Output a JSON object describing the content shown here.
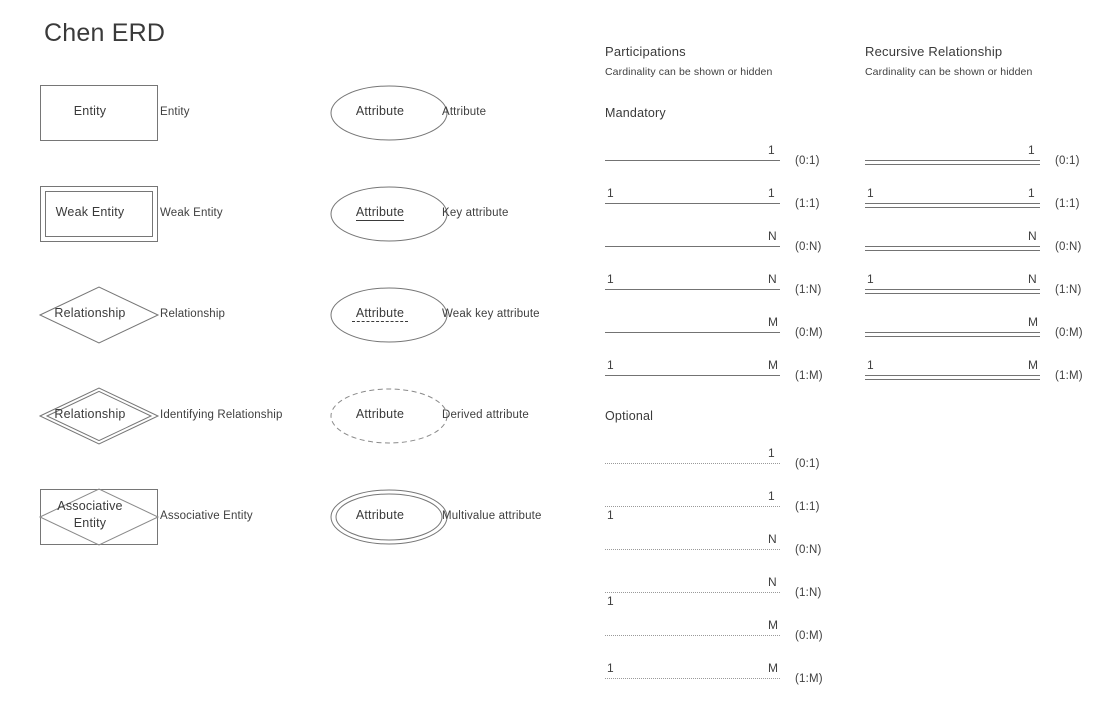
{
  "title": "Chen ERD",
  "entity_legend": [
    {
      "shape": "rectangle",
      "shape_text": "Entity",
      "label": "Entity"
    },
    {
      "shape": "double-rectangle",
      "shape_text": "Weak Entity",
      "label": "Weak Entity"
    },
    {
      "shape": "diamond",
      "shape_text": "Relationship",
      "label": "Relationship"
    },
    {
      "shape": "double-diamond",
      "shape_text": "Relationship",
      "label": "Identifying Relationship"
    },
    {
      "shape": "rect-diamond",
      "shape_text": "Associative\nEntity",
      "label": "Associative Entity"
    }
  ],
  "attribute_legend": [
    {
      "shape": "ellipse",
      "shape_text": "Attribute",
      "underline": "none",
      "label": "Attribute"
    },
    {
      "shape": "ellipse",
      "shape_text": "Attribute",
      "underline": "solid",
      "label": "Key attribute"
    },
    {
      "shape": "ellipse",
      "shape_text": "Attribute",
      "underline": "dashed",
      "label": "Weak key attribute"
    },
    {
      "shape": "dashed-ellipse",
      "shape_text": "Attribute",
      "underline": "none",
      "label": "Derived attribute"
    },
    {
      "shape": "double-ellipse",
      "shape_text": "Attribute",
      "underline": "none",
      "label": "Multivalue attribute"
    }
  ],
  "participations": {
    "title": "Participations",
    "subtitle": "Cardinality can be shown or hidden",
    "groups": [
      {
        "heading": "Mandatory",
        "line_style": "solid",
        "rows": [
          {
            "left": "",
            "right": "1",
            "tag": "(0:1)",
            "left_below": false
          },
          {
            "left": "1",
            "right": "1",
            "tag": "(1:1)",
            "left_below": false
          },
          {
            "left": "",
            "right": "N",
            "tag": "(0:N)",
            "left_below": false
          },
          {
            "left": "1",
            "right": "N",
            "tag": "(1:N)",
            "left_below": false
          },
          {
            "left": "",
            "right": "M",
            "tag": "(0:M)",
            "left_below": false
          },
          {
            "left": "1",
            "right": "M",
            "tag": "(1:M)",
            "left_below": false
          }
        ]
      },
      {
        "heading": "Optional",
        "line_style": "dotted",
        "rows": [
          {
            "left": "",
            "right": "1",
            "tag": "(0:1)",
            "left_below": false
          },
          {
            "left": "1",
            "right": "1",
            "tag": "(1:1)",
            "left_below": true
          },
          {
            "left": "",
            "right": "N",
            "tag": "(0:N)",
            "left_below": false
          },
          {
            "left": "1",
            "right": "N",
            "tag": "(1:N)",
            "left_below": true
          },
          {
            "left": "",
            "right": "M",
            "tag": "(0:M)",
            "left_below": false
          },
          {
            "left": "1",
            "right": "M",
            "tag": "(1:M)",
            "left_below": false
          }
        ]
      }
    ]
  },
  "recursive": {
    "title": "Recursive Relationship",
    "subtitle": "Cardinality can be shown or hidden",
    "line_style": "double",
    "rows": [
      {
        "left": "",
        "right": "1",
        "tag": "(0:1)"
      },
      {
        "left": "1",
        "right": "1",
        "tag": "(1:1)"
      },
      {
        "left": "",
        "right": "N",
        "tag": "(0:N)"
      },
      {
        "left": "1",
        "right": "N",
        "tag": "(1:N)"
      },
      {
        "left": "",
        "right": "M",
        "tag": "(0:M)"
      },
      {
        "left": "1",
        "right": "M",
        "tag": "(1:M)"
      }
    ]
  },
  "colors": {
    "text": "#3f3f3f",
    "shape_stroke": "#767676",
    "light_stroke": "#8a8a8a",
    "line": "#737373",
    "background": "#ffffff"
  }
}
